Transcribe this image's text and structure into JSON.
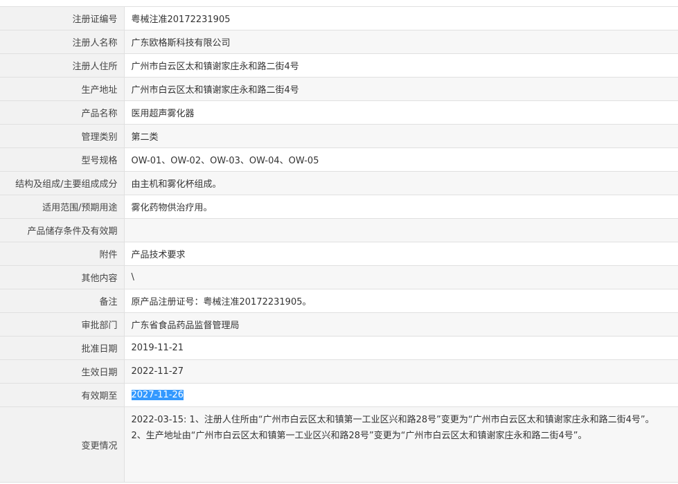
{
  "rows": [
    {
      "label": "注册证编号",
      "value": "粤械注准20172231905"
    },
    {
      "label": "注册人名称",
      "value": "广东欧格斯科技有限公司"
    },
    {
      "label": "注册人住所",
      "value": "广州市白云区太和镇谢家庄永和路二街4号"
    },
    {
      "label": "生产地址",
      "value": "广州市白云区太和镇谢家庄永和路二街4号"
    },
    {
      "label": "产品名称",
      "value": "医用超声雾化器"
    },
    {
      "label": "管理类别",
      "value": "第二类"
    },
    {
      "label": "型号规格",
      "value": "OW-01、OW-02、OW-03、OW-04、OW-05"
    },
    {
      "label": "结构及组成/主要组成成分",
      "value": "由主机和雾化杯组成。"
    },
    {
      "label": "适用范围/预期用途",
      "value": "雾化药物供治疗用。"
    },
    {
      "label": "产品储存条件及有效期",
      "value": ""
    },
    {
      "label": "附件",
      "value": "产品技术要求"
    },
    {
      "label": "其他内容",
      "value": "\\"
    },
    {
      "label": "备注",
      "value": "原产品注册证号：粤械注准20172231905。"
    },
    {
      "label": "审批部门",
      "value": "广东省食品药品监督管理局"
    },
    {
      "label": "批准日期",
      "value": "2019-11-21"
    },
    {
      "label": "生效日期",
      "value": "2022-11-27"
    },
    {
      "label": "有效期至",
      "value": "2027-11-26"
    }
  ],
  "change": {
    "label": "变更情况",
    "line1": "2022-03-15: 1、注册人住所由“广州市白云区太和镇第一工业区兴和路28号”变更为“广州市白云区太和镇谢家庄永和路二街4号”。",
    "line2": "2、生产地址由“广州市白云区太和镇第一工业区兴和路28号”变更为“广州市白云区太和镇谢家庄永和路二街4号”。"
  }
}
